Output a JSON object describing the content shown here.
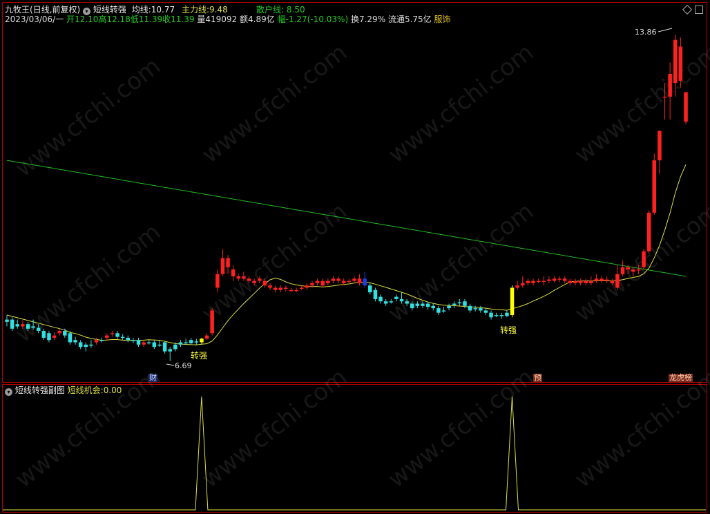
{
  "header": {
    "stock_name": "九牧王",
    "period": "(日线,前复权)",
    "indicator_name": "短线转强",
    "ma_label": "均线:",
    "ma_value": "10.77",
    "main_force_label": "主力线:",
    "main_force_value": "9.48",
    "retail_label": "散户线:",
    "retail_value": "8.50"
  },
  "quote": {
    "date": "2023/03/06/一",
    "open_label": "开",
    "open": "12.10",
    "high_label": "高",
    "high": "12.18",
    "low_label": "低",
    "low": "11.39",
    "close_label": "收",
    "close": "11.39",
    "volume_label": "量",
    "volume": "419092",
    "amount_label": "额",
    "amount": "4.89亿",
    "change_label": "幅",
    "change": "-1.27(-10.03%)",
    "turnover_label": "换",
    "turnover": "7.29%",
    "float_label": "流通",
    "float_cap": "5.75亿",
    "sector": "服饰"
  },
  "annotations": {
    "max_price": "13.86",
    "min_price": "6.69",
    "signal_label": "转强",
    "badge_cai": "财",
    "badge_yu": "预",
    "badge_longhu": "龙虎榜"
  },
  "sub_panel": {
    "title": "短线转强副图",
    "line_label": "短线机会:",
    "line_value": "0.00"
  },
  "watermark": "www.cfchi.com",
  "colors": {
    "up": "#ff2020",
    "down": "#33e0e0",
    "signal": "#ffff00",
    "blue_candle": "#1f3fe0",
    "green_line": "#22bb22",
    "yellow_line": "#e0e040",
    "border": "#b00000"
  },
  "chart_data": {
    "type": "candlestick",
    "price_range": [
      6.5,
      14.2
    ],
    "candles": [
      [
        7.55,
        7.6,
        7.7,
        7.45,
        "d"
      ],
      [
        7.6,
        7.4,
        7.65,
        7.35,
        "d"
      ],
      [
        7.5,
        7.45,
        7.6,
        7.4,
        "d"
      ],
      [
        7.45,
        7.5,
        7.58,
        7.4,
        "u"
      ],
      [
        7.5,
        7.4,
        7.55,
        7.35,
        "d"
      ],
      [
        7.45,
        7.42,
        7.6,
        7.38,
        "d"
      ],
      [
        7.42,
        7.35,
        7.5,
        7.3,
        "d"
      ],
      [
        7.35,
        7.2,
        7.4,
        7.15,
        "d"
      ],
      [
        7.3,
        7.15,
        7.35,
        7.1,
        "d"
      ],
      [
        7.2,
        7.25,
        7.32,
        7.15,
        "u"
      ],
      [
        7.3,
        7.35,
        7.4,
        7.25,
        "u"
      ],
      [
        7.35,
        7.25,
        7.4,
        7.2,
        "d"
      ],
      [
        7.3,
        7.1,
        7.35,
        7.05,
        "d"
      ],
      [
        7.15,
        7.1,
        7.22,
        7.05,
        "d"
      ],
      [
        7.1,
        7.0,
        7.15,
        6.95,
        "d"
      ],
      [
        7.05,
        7.0,
        7.1,
        6.9,
        "d"
      ],
      [
        7.05,
        7.05,
        7.15,
        6.98,
        "d"
      ],
      [
        7.1,
        7.15,
        7.2,
        7.05,
        "u"
      ],
      [
        7.15,
        7.15,
        7.2,
        7.1,
        "d"
      ],
      [
        7.2,
        7.25,
        7.3,
        7.15,
        "u"
      ],
      [
        7.28,
        7.3,
        7.35,
        7.22,
        "u"
      ],
      [
        7.3,
        7.22,
        7.35,
        7.18,
        "d"
      ],
      [
        7.22,
        7.2,
        7.28,
        7.15,
        "d"
      ],
      [
        7.2,
        7.15,
        7.25,
        7.1,
        "d"
      ],
      [
        7.15,
        7.15,
        7.2,
        7.08,
        "d"
      ],
      [
        7.15,
        7.05,
        7.2,
        7.0,
        "d"
      ],
      [
        7.05,
        7.1,
        7.15,
        7.0,
        "u"
      ],
      [
        7.1,
        7.1,
        7.15,
        7.05,
        "d"
      ],
      [
        7.1,
        7.0,
        7.15,
        6.95,
        "d"
      ],
      [
        7.05,
        7.05,
        7.15,
        7.0,
        "d"
      ],
      [
        7.1,
        6.9,
        7.12,
        6.85,
        "d"
      ],
      [
        6.95,
        6.9,
        7.0,
        6.69,
        "d"
      ],
      [
        6.95,
        7.05,
        7.1,
        6.9,
        "d"
      ],
      [
        7.05,
        7.1,
        7.15,
        7.0,
        "d"
      ],
      [
        7.1,
        7.1,
        7.18,
        7.05,
        "d"
      ],
      [
        7.15,
        7.08,
        7.2,
        7.05,
        "d"
      ],
      [
        7.1,
        7.12,
        7.18,
        7.05,
        "d"
      ],
      [
        7.1,
        7.18,
        7.2,
        7.05,
        "s"
      ],
      [
        7.18,
        7.25,
        7.3,
        7.15,
        "u"
      ],
      [
        7.3,
        7.8,
        7.85,
        7.25,
        "u"
      ],
      [
        8.3,
        8.6,
        8.7,
        8.2,
        "u"
      ],
      [
        8.6,
        8.95,
        9.15,
        8.55,
        "u"
      ],
      [
        8.95,
        8.75,
        9.02,
        8.6,
        "u"
      ],
      [
        8.7,
        8.55,
        8.8,
        8.45,
        "u"
      ],
      [
        8.55,
        8.5,
        8.6,
        8.45,
        "u"
      ],
      [
        8.5,
        8.55,
        8.65,
        8.45,
        "u"
      ],
      [
        8.5,
        8.45,
        8.55,
        8.4,
        "u"
      ],
      [
        8.45,
        8.4,
        8.5,
        8.35,
        "u"
      ],
      [
        8.45,
        8.5,
        8.55,
        8.4,
        "u"
      ],
      [
        8.45,
        8.35,
        8.5,
        8.3,
        "u"
      ],
      [
        8.35,
        8.3,
        8.4,
        8.25,
        "u"
      ],
      [
        8.3,
        8.25,
        8.35,
        8.2,
        "u"
      ],
      [
        8.3,
        8.25,
        8.35,
        8.2,
        "u"
      ],
      [
        8.3,
        8.3,
        8.35,
        8.22,
        "u"
      ],
      [
        8.25,
        8.25,
        8.3,
        8.2,
        "u"
      ],
      [
        8.25,
        8.25,
        8.3,
        8.2,
        "u"
      ],
      [
        8.3,
        8.3,
        8.35,
        8.25,
        "u"
      ],
      [
        8.3,
        8.35,
        8.4,
        8.25,
        "u"
      ],
      [
        8.35,
        8.4,
        8.45,
        8.3,
        "u"
      ],
      [
        8.4,
        8.45,
        8.5,
        8.35,
        "u"
      ],
      [
        8.45,
        8.35,
        8.5,
        8.3,
        "u"
      ],
      [
        8.4,
        8.45,
        8.5,
        8.35,
        "u"
      ],
      [
        8.45,
        8.5,
        8.55,
        8.4,
        "u"
      ],
      [
        8.5,
        8.45,
        8.55,
        8.4,
        "u"
      ],
      [
        8.45,
        8.4,
        8.5,
        8.35,
        "u"
      ],
      [
        8.45,
        8.45,
        8.5,
        8.4,
        "u"
      ],
      [
        8.45,
        8.5,
        8.55,
        8.4,
        "u"
      ],
      [
        8.5,
        8.4,
        8.6,
        8.35,
        "u"
      ],
      [
        8.5,
        8.35,
        8.65,
        8.3,
        "b"
      ],
      [
        8.35,
        8.2,
        8.4,
        8.15,
        "d"
      ],
      [
        8.25,
        8.05,
        8.3,
        8.0,
        "d"
      ],
      [
        8.1,
        8.0,
        8.15,
        7.95,
        "d"
      ],
      [
        8.0,
        7.95,
        8.05,
        7.9,
        "d"
      ],
      [
        8.0,
        8.0,
        8.05,
        7.95,
        "d"
      ],
      [
        8.05,
        8.1,
        8.15,
        8.0,
        "d"
      ],
      [
        8.05,
        8.0,
        8.2,
        7.95,
        "d"
      ],
      [
        8.0,
        7.95,
        8.05,
        7.9,
        "d"
      ],
      [
        7.95,
        7.85,
        8.0,
        7.8,
        "d"
      ],
      [
        7.9,
        7.95,
        8.0,
        7.85,
        "d"
      ],
      [
        7.95,
        7.9,
        8.0,
        7.85,
        "d"
      ],
      [
        7.95,
        7.88,
        8.0,
        7.82,
        "d"
      ],
      [
        7.9,
        7.85,
        7.95,
        7.8,
        "d"
      ],
      [
        7.85,
        7.75,
        7.9,
        7.7,
        "d"
      ],
      [
        7.8,
        7.8,
        7.88,
        7.75,
        "d"
      ],
      [
        7.85,
        7.9,
        7.95,
        7.8,
        "d"
      ],
      [
        7.92,
        7.95,
        8.0,
        7.85,
        "d"
      ],
      [
        7.98,
        7.98,
        8.05,
        7.9,
        "d"
      ],
      [
        8.0,
        7.9,
        8.05,
        7.85,
        "d"
      ],
      [
        7.9,
        7.8,
        7.95,
        7.75,
        "d"
      ],
      [
        7.85,
        7.85,
        7.9,
        7.78,
        "d"
      ],
      [
        7.85,
        7.8,
        7.9,
        7.75,
        "d"
      ],
      [
        7.8,
        7.75,
        7.85,
        7.7,
        "d"
      ],
      [
        7.75,
        7.65,
        7.8,
        7.6,
        "d"
      ],
      [
        7.7,
        7.7,
        7.75,
        7.65,
        "d"
      ],
      [
        7.7,
        7.7,
        7.75,
        7.62,
        "d"
      ],
      [
        7.75,
        7.68,
        7.8,
        7.65,
        "d"
      ],
      [
        7.7,
        8.3,
        8.35,
        7.65,
        "s"
      ],
      [
        8.3,
        8.35,
        8.45,
        8.25,
        "u"
      ],
      [
        8.35,
        8.4,
        8.55,
        8.3,
        "u"
      ],
      [
        8.4,
        8.45,
        8.5,
        8.35,
        "u"
      ],
      [
        8.4,
        8.45,
        8.5,
        8.35,
        "u"
      ],
      [
        8.45,
        8.45,
        8.5,
        8.4,
        "u"
      ],
      [
        8.45,
        8.45,
        8.55,
        8.35,
        "u"
      ],
      [
        8.45,
        8.48,
        8.55,
        8.4,
        "u"
      ],
      [
        8.45,
        8.5,
        8.55,
        8.42,
        "u"
      ],
      [
        8.5,
        8.48,
        8.55,
        8.42,
        "u"
      ],
      [
        8.5,
        8.45,
        8.55,
        8.4,
        "u"
      ],
      [
        8.45,
        8.4,
        8.5,
        8.35,
        "u"
      ],
      [
        8.4,
        8.45,
        8.5,
        8.35,
        "u"
      ],
      [
        8.45,
        8.4,
        8.5,
        8.35,
        "u"
      ],
      [
        8.4,
        8.45,
        8.5,
        8.35,
        "u"
      ],
      [
        8.45,
        8.4,
        8.55,
        8.35,
        "u"
      ],
      [
        8.45,
        8.5,
        8.6,
        8.4,
        "u"
      ],
      [
        8.5,
        8.45,
        8.55,
        8.4,
        "u"
      ],
      [
        8.45,
        8.48,
        8.55,
        8.4,
        "u"
      ],
      [
        8.45,
        8.4,
        8.5,
        8.35,
        "u"
      ],
      [
        8.3,
        8.6,
        8.8,
        8.25,
        "u"
      ],
      [
        8.6,
        8.75,
        8.9,
        8.55,
        "u"
      ],
      [
        8.7,
        8.75,
        8.8,
        8.6,
        "u"
      ],
      [
        8.65,
        8.7,
        8.75,
        8.55,
        "u"
      ],
      [
        8.7,
        8.7,
        8.8,
        8.6,
        "u"
      ],
      [
        8.75,
        9.1,
        9.15,
        8.7,
        "u"
      ],
      [
        9.1,
        9.95,
        10.0,
        9.05,
        "u"
      ],
      [
        9.95,
        11.1,
        11.25,
        9.9,
        "u"
      ],
      [
        11.1,
        11.75,
        11.75,
        10.8,
        "u"
      ],
      [
        12.5,
        12.5,
        12.8,
        12.0,
        "u"
      ],
      [
        12.5,
        13.0,
        13.25,
        12.0,
        "u"
      ],
      [
        12.8,
        13.75,
        13.86,
        12.5,
        "u"
      ],
      [
        13.6,
        12.85,
        13.8,
        12.7,
        "u"
      ],
      [
        12.6,
        11.95,
        12.6,
        11.9,
        "u"
      ]
    ],
    "signal_days": [
      37,
      96
    ],
    "sub_panel": {
      "series": "短线机会",
      "values": [
        0,
        1,
        0,
        1,
        0
      ]
    }
  }
}
